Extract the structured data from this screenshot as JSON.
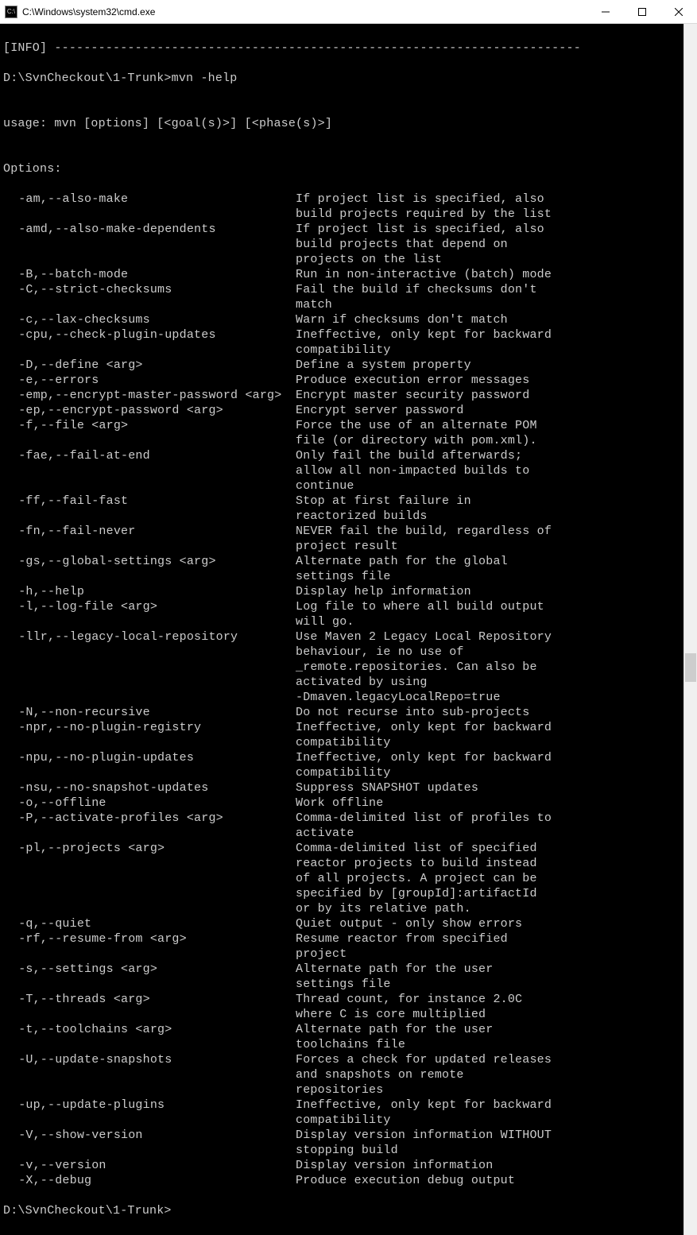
{
  "window": {
    "title": "C:\\Windows\\system32\\cmd.exe"
  },
  "terminal": {
    "info_line": "[INFO] ------------------------------------------------------------------------",
    "prompt1": "D:\\SvnCheckout\\1-Trunk>mvn -help",
    "blank": "",
    "usage": "usage: mvn [options] [<goal(s)>] [<phase(s)>]",
    "options_header": "Options:",
    "options": [
      {
        "flag": "-am,--also-make",
        "desc": "If project list is specified, also build projects required by the list"
      },
      {
        "flag": "-amd,--also-make-dependents",
        "desc": "If project list is specified, also build projects that depend on projects on the list"
      },
      {
        "flag": "-B,--batch-mode",
        "desc": "Run in non-interactive (batch) mode"
      },
      {
        "flag": "-C,--strict-checksums",
        "desc": "Fail the build if checksums don't match"
      },
      {
        "flag": "-c,--lax-checksums",
        "desc": "Warn if checksums don't match"
      },
      {
        "flag": "-cpu,--check-plugin-updates",
        "desc": "Ineffective, only kept for backward compatibility"
      },
      {
        "flag": "-D,--define <arg>",
        "desc": "Define a system property"
      },
      {
        "flag": "-e,--errors",
        "desc": "Produce execution error messages"
      },
      {
        "flag": "-emp,--encrypt-master-password <arg>",
        "desc": "Encrypt master security password"
      },
      {
        "flag": "-ep,--encrypt-password <arg>",
        "desc": "Encrypt server password"
      },
      {
        "flag": "-f,--file <arg>",
        "desc": "Force the use of an alternate POM file (or directory with pom.xml)."
      },
      {
        "flag": "-fae,--fail-at-end",
        "desc": "Only fail the build afterwards; allow all non-impacted builds to continue"
      },
      {
        "flag": "-ff,--fail-fast",
        "desc": "Stop at first failure in reactorized builds"
      },
      {
        "flag": "-fn,--fail-never",
        "desc": "NEVER fail the build, regardless of project result"
      },
      {
        "flag": "-gs,--global-settings <arg>",
        "desc": "Alternate path for the global settings file"
      },
      {
        "flag": "-h,--help",
        "desc": "Display help information"
      },
      {
        "flag": "-l,--log-file <arg>",
        "desc": "Log file to where all build output will go."
      },
      {
        "flag": "-llr,--legacy-local-repository",
        "desc": "Use Maven 2 Legacy Local Repository behaviour, ie no use of _remote.repositories. Can also be activated by using -Dmaven.legacyLocalRepo=true"
      },
      {
        "flag": "-N,--non-recursive",
        "desc": "Do not recurse into sub-projects"
      },
      {
        "flag": "-npr,--no-plugin-registry",
        "desc": "Ineffective, only kept for backward compatibility"
      },
      {
        "flag": "-npu,--no-plugin-updates",
        "desc": "Ineffective, only kept for backward compatibility"
      },
      {
        "flag": "-nsu,--no-snapshot-updates",
        "desc": "Suppress SNAPSHOT updates"
      },
      {
        "flag": "-o,--offline",
        "desc": "Work offline"
      },
      {
        "flag": "-P,--activate-profiles <arg>",
        "desc": "Comma-delimited list of profiles to activate"
      },
      {
        "flag": "-pl,--projects <arg>",
        "desc": "Comma-delimited list of specified reactor projects to build instead of all projects. A project can be specified by [groupId]:artifactId or by its relative path."
      },
      {
        "flag": "-q,--quiet",
        "desc": "Quiet output - only show errors"
      },
      {
        "flag": "-rf,--resume-from <arg>",
        "desc": "Resume reactor from specified project"
      },
      {
        "flag": "-s,--settings <arg>",
        "desc": "Alternate path for the user settings file"
      },
      {
        "flag": "-T,--threads <arg>",
        "desc": "Thread count, for instance 2.0C where C is core multiplied"
      },
      {
        "flag": "-t,--toolchains <arg>",
        "desc": "Alternate path for the user toolchains file"
      },
      {
        "flag": "-U,--update-snapshots",
        "desc": "Forces a check for updated releases and snapshots on remote repositories"
      },
      {
        "flag": "-up,--update-plugins",
        "desc": "Ineffective, only kept for backward compatibility"
      },
      {
        "flag": "-V,--show-version",
        "desc": "Display version information WITHOUT stopping build"
      },
      {
        "flag": "-v,--version",
        "desc": "Display version information"
      },
      {
        "flag": "-X,--debug",
        "desc": "Produce execution debug output"
      }
    ],
    "prompt2": "D:\\SvnCheckout\\1-Trunk>"
  }
}
